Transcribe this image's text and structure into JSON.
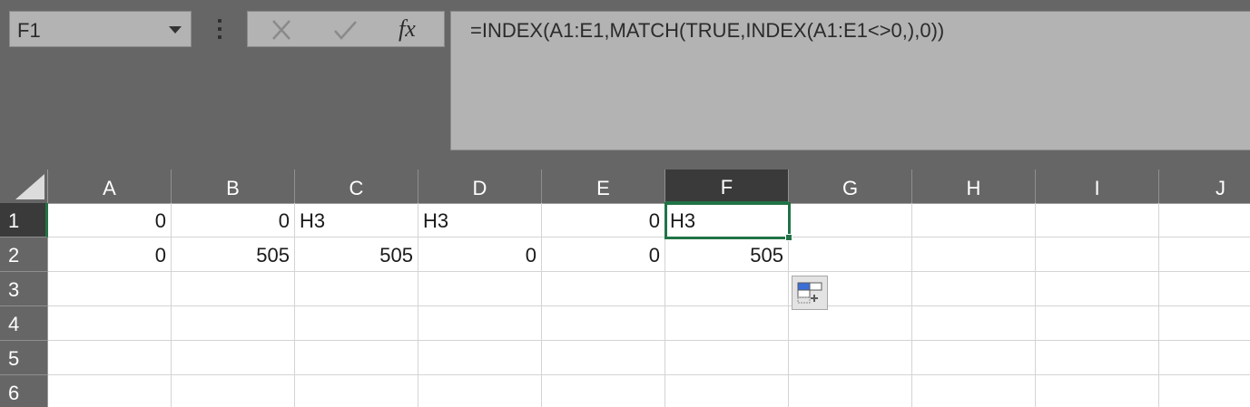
{
  "name_box": {
    "value": "F1"
  },
  "formula_bar": {
    "cancel_icon": "cancel-x",
    "enter_icon": "checkmark",
    "fx_label": "fx",
    "formula": "=INDEX(A1:E1,MATCH(TRUE,INDEX(A1:E1<>0,),0))"
  },
  "columns": [
    "A",
    "B",
    "C",
    "D",
    "E",
    "F",
    "G",
    "H",
    "I",
    "J"
  ],
  "rows": [
    "1",
    "2",
    "3",
    "4",
    "5",
    "6"
  ],
  "active_cell": {
    "column": "F",
    "row": "1"
  },
  "cells": {
    "row1": [
      "0",
      "0",
      "H3",
      "H3",
      "0",
      "H3",
      "",
      "",
      "",
      ""
    ],
    "row2": [
      "0",
      "505",
      "505",
      "0",
      "0",
      "505",
      "",
      "",
      "",
      ""
    ]
  },
  "colors": {
    "accent": "#217346",
    "chrome": "#666666",
    "input_bg": "#b3b3b3"
  }
}
